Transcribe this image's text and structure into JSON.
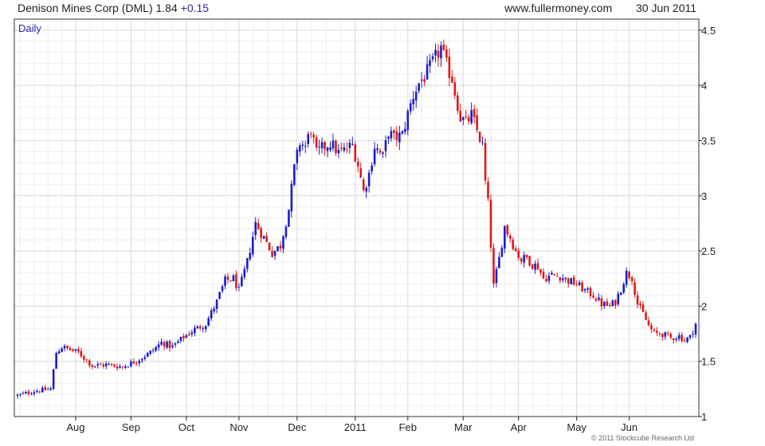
{
  "header": {
    "title": "Denison Mines Corp (DML) 1.84",
    "change": "+0.15",
    "site": "www.fullermoney.com",
    "date": "30 Jun 2011"
  },
  "footer": {
    "copyright": "© 2011 Stockcube Research Ltd"
  },
  "colors": {
    "up": "#1c1ccc",
    "down": "#e01818",
    "grid": "#d8d8d8",
    "grid_minor": "#ededed",
    "axis": "#222222"
  },
  "chart_data": {
    "type": "candlestick",
    "title": "Denison Mines Corp (DML) 1.84",
    "period_label": "Daily",
    "y_axis": {
      "side": "right",
      "ylim": [
        1.0,
        4.6
      ],
      "ticks": [
        1,
        1.5,
        2,
        2.5,
        3,
        3.5,
        4,
        4.5
      ],
      "tick_labels": [
        "1",
        "1.5",
        "2",
        "2.5",
        "3",
        "3.5",
        "4",
        "4.5"
      ]
    },
    "x_axis": {
      "range": [
        0,
        245
      ],
      "ticks": [
        {
          "label": "Aug",
          "x": 21
        },
        {
          "label": "Sep",
          "x": 41
        },
        {
          "label": "Oct",
          "x": 61
        },
        {
          "label": "Nov",
          "x": 80
        },
        {
          "label": "Dec",
          "x": 101
        },
        {
          "label": "2011",
          "x": 122
        },
        {
          "label": "Feb",
          "x": 141
        },
        {
          "label": "Mar",
          "x": 161
        },
        {
          "label": "Apr",
          "x": 181
        },
        {
          "label": "May",
          "x": 202
        },
        {
          "label": "Jun",
          "x": 221
        }
      ]
    },
    "grid": true,
    "close_path": [
      [
        0,
        1.19
      ],
      [
        6,
        1.23
      ],
      [
        12,
        1.25
      ],
      [
        14,
        1.58
      ],
      [
        16,
        1.63
      ],
      [
        22,
        1.58
      ],
      [
        27,
        1.46
      ],
      [
        32,
        1.47
      ],
      [
        38,
        1.45
      ],
      [
        44,
        1.52
      ],
      [
        48,
        1.58
      ],
      [
        52,
        1.67
      ],
      [
        56,
        1.63
      ],
      [
        60,
        1.72
      ],
      [
        64,
        1.79
      ],
      [
        68,
        1.84
      ],
      [
        72,
        2.04
      ],
      [
        75,
        2.23
      ],
      [
        78,
        2.25
      ],
      [
        80,
        2.14
      ],
      [
        83,
        2.4
      ],
      [
        86,
        2.75
      ],
      [
        89,
        2.62
      ],
      [
        92,
        2.48
      ],
      [
        95,
        2.55
      ],
      [
        98,
        2.88
      ],
      [
        100,
        3.25
      ],
      [
        102,
        3.48
      ],
      [
        104,
        3.45
      ],
      [
        106,
        3.6
      ],
      [
        108,
        3.38
      ],
      [
        110,
        3.43
      ],
      [
        113,
        3.48
      ],
      [
        116,
        3.39
      ],
      [
        118,
        3.41
      ],
      [
        121,
        3.46
      ],
      [
        123,
        3.28
      ],
      [
        125,
        3.04
      ],
      [
        127,
        3.2
      ],
      [
        129,
        3.45
      ],
      [
        132,
        3.35
      ],
      [
        134,
        3.58
      ],
      [
        136,
        3.52
      ],
      [
        139,
        3.55
      ],
      [
        141,
        3.74
      ],
      [
        143,
        3.91
      ],
      [
        145,
        4.02
      ],
      [
        147,
        4.08
      ],
      [
        149,
        4.16
      ],
      [
        151,
        4.25
      ],
      [
        153,
        4.34
      ],
      [
        155,
        4.18
      ],
      [
        157,
        4.06
      ],
      [
        158,
        3.94
      ],
      [
        160,
        3.71
      ],
      [
        162,
        3.66
      ],
      [
        164,
        3.73
      ],
      [
        166,
        3.59
      ],
      [
        168,
        3.45
      ],
      [
        169,
        3.12
      ],
      [
        170,
        2.93
      ],
      [
        172,
        2.18
      ],
      [
        174,
        2.43
      ],
      [
        176,
        2.72
      ],
      [
        178,
        2.62
      ],
      [
        180,
        2.5
      ],
      [
        182,
        2.42
      ],
      [
        184,
        2.44
      ],
      [
        186,
        2.38
      ],
      [
        188,
        2.36
      ],
      [
        190,
        2.25
      ],
      [
        193,
        2.28
      ],
      [
        196,
        2.27
      ],
      [
        199,
        2.23
      ],
      [
        202,
        2.2
      ],
      [
        205,
        2.14
      ],
      [
        208,
        2.1
      ],
      [
        211,
        2.02
      ],
      [
        214,
        2.0
      ],
      [
        216,
        2.04
      ],
      [
        218,
        2.16
      ],
      [
        220,
        2.3
      ],
      [
        222,
        2.26
      ],
      [
        224,
        2.02
      ],
      [
        226,
        1.93
      ],
      [
        228,
        1.82
      ],
      [
        230,
        1.75
      ],
      [
        233,
        1.75
      ],
      [
        236,
        1.71
      ],
      [
        239,
        1.73
      ],
      [
        241,
        1.69
      ],
      [
        243,
        1.72
      ],
      [
        245,
        1.84
      ]
    ]
  }
}
